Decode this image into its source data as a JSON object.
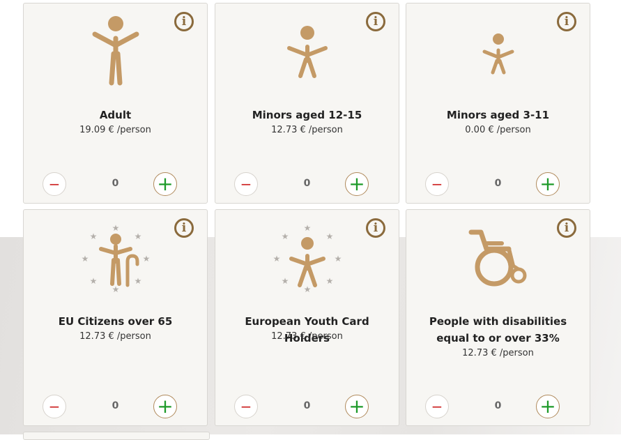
{
  "cards": [
    {
      "title": "Adult",
      "price": "19.09 € /person",
      "qty": "0",
      "icon": "adult-icon"
    },
    {
      "title": "Minors aged 12-15",
      "price": "12.73 € /person",
      "qty": "0",
      "icon": "minor-12-15-icon"
    },
    {
      "title": "Minors aged 3-11",
      "price": "0.00 € /person",
      "qty": "0",
      "icon": "minor-3-11-icon"
    },
    {
      "title": "EU Citizens over 65",
      "price": "12.73 € /person",
      "qty": "0",
      "icon": "eu-senior-icon"
    },
    {
      "title": "European Youth Card Holders",
      "price": "12.73 € /person",
      "qty": "0",
      "icon": "youth-card-icon"
    },
    {
      "title": "People with disabilities equal to or over 33%",
      "price": "12.73 € /person",
      "qty": "0",
      "icon": "wheelchair-icon"
    }
  ],
  "labels": {
    "minus": "−",
    "plus": "+",
    "info": "i"
  },
  "colors": {
    "icon": "#c49a66",
    "info": "#8a6a3c",
    "minus": "#cc1f1f",
    "plus": "#1e9a2a",
    "star": "#b4b0ab"
  }
}
